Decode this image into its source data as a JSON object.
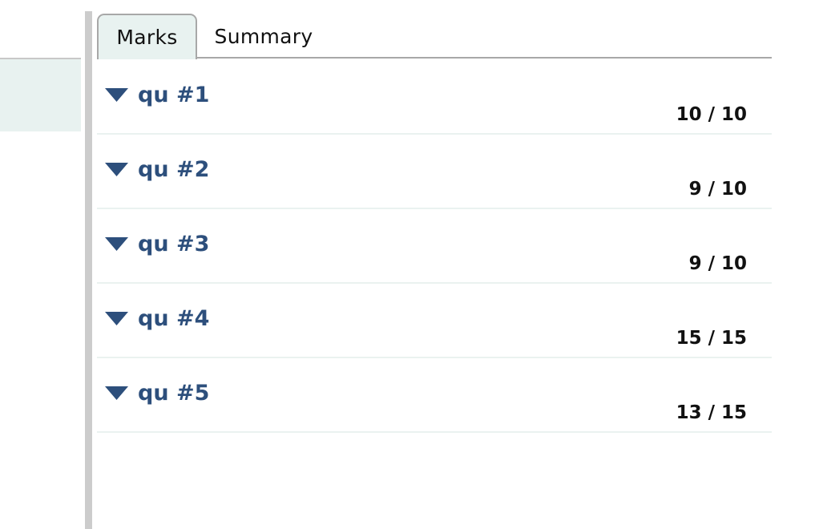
{
  "tabs": [
    {
      "label": "Marks",
      "active": true
    },
    {
      "label": "Summary",
      "active": false
    }
  ],
  "questions": [
    {
      "title": "qu #1",
      "score": "10 / 10",
      "expanded": true
    },
    {
      "title": "qu #2",
      "score": "9 / 10",
      "expanded": true
    },
    {
      "title": "qu #3",
      "score": "9 / 10",
      "expanded": true
    },
    {
      "title": "qu #4",
      "score": "15 / 15",
      "expanded": true
    },
    {
      "title": "qu #5",
      "score": "13 / 15",
      "expanded": true
    }
  ],
  "colors": {
    "accent": "#2d4f7c",
    "active_tab_bg": "#e8f2f0",
    "splitter": "#cccccc"
  },
  "icons": {
    "row_toggle": "caret-down-icon"
  }
}
